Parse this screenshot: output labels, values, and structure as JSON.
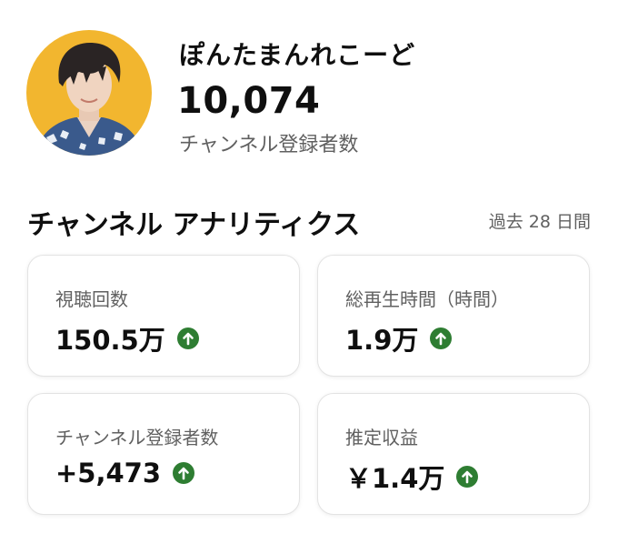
{
  "channel": {
    "name": "ぽんたまんれこーど",
    "subscriber_count": "10,074",
    "subscriber_label": "チャンネル登録者数"
  },
  "analytics": {
    "title": "チャンネル アナリティクス",
    "period": "過去 28 日間",
    "cards": [
      {
        "label": "視聴回数",
        "value": "150.5万",
        "trend": "up"
      },
      {
        "label": "総再生時間（時間）",
        "value": "1.9万",
        "trend": "up"
      },
      {
        "label": "チャンネル登録者数",
        "value": "+5,473",
        "trend": "up"
      },
      {
        "label": "推定収益",
        "value": "￥1.4万",
        "trend": "up"
      }
    ]
  },
  "colors": {
    "avatar_background": "#f2b62f",
    "trend_up": "#2e7d32",
    "secondary_text": "#606060"
  },
  "icons": {
    "trend": "arrow-up-circle-icon",
    "avatar": "channel-avatar"
  }
}
